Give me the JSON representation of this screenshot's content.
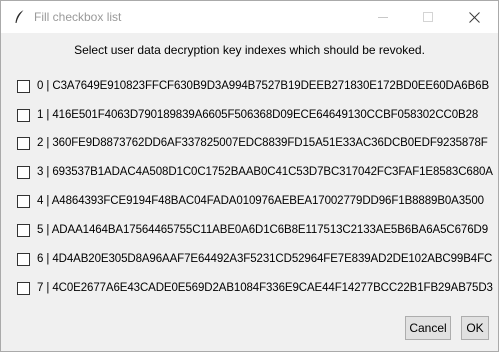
{
  "window": {
    "title": "Fill checkbox list"
  },
  "dialog": {
    "header": "Select user data decryption key indexes which should be revoked.",
    "items": [
      {
        "index": "0",
        "label": "0 | C3A7649E910823FFCF630B9D3A994B7527B19DEEB271830E172BD0EE60DA6B6B",
        "checked": false
      },
      {
        "index": "1",
        "label": "1 | 416E501F4063D790189839A6605F506368D09ECE64649130CCBF058302CC0B28",
        "checked": false
      },
      {
        "index": "2",
        "label": "2 | 360FE9D8873762DD6AF337825007EDC8839FD15A51E33AC36DCB0EDF9235878F",
        "checked": false
      },
      {
        "index": "3",
        "label": "3 | 693537B1ADAC4A508D1C0C1752BAAB0C41C53D7BC317042FC3FAF1E8583C680A",
        "checked": false
      },
      {
        "index": "4",
        "label": "4 | A4864393FCE9194F48BAC04FADA010976AEBEA17002779DD96F1B8889B0A3500",
        "checked": false
      },
      {
        "index": "5",
        "label": "5 | ADAA1464BA17564465755C11ABE0A6D1C6B8E117513C2133AE5B6BA6A5C676D9",
        "checked": false
      },
      {
        "index": "6",
        "label": "6 | 4D4AB20E305D8A96AAF7E64492A3F5231CD52964FE7E839AD2DE102ABC99B4FC",
        "checked": false
      },
      {
        "index": "7",
        "label": "7 | 4C0E2677A6E43CADE0E569D2AB1084F336E9CAE44F14277BCC22B1FB29AB75D3",
        "checked": false
      }
    ],
    "cancel_label": "Cancel",
    "ok_label": "OK"
  },
  "icons": {
    "app": "feather-icon",
    "minimize": "minimize-icon",
    "maximize": "maximize-icon",
    "close": "close-icon"
  }
}
